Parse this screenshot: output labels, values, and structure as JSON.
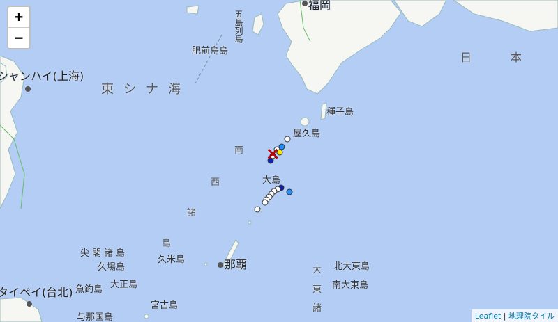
{
  "zoom": {
    "in_label": "+",
    "out_label": "−"
  },
  "labels": {
    "fukuoka": "福岡",
    "goto": "五島列島",
    "hizen": "肥前鳥島",
    "shanghai": "シャンハイ(上海)",
    "east_china_sea": "東シナ海",
    "japan": "日　本",
    "tanegashima": "種子島",
    "yakushima": "屋久島",
    "nansei_1": "南",
    "nansei_2": "西",
    "nansei_3": "諸",
    "nansei_4": "島",
    "oshima": "大島",
    "senkaku": "尖閣諸島",
    "kubashima": "久場島",
    "kumejima": "久米島",
    "naha": "那覇",
    "kitadaito": "北大東島",
    "minamidaito": "南大東島",
    "daito_1": "大",
    "daito_2": "東",
    "daito_3": "諸",
    "uotsuri": "魚釣島",
    "taisho": "大正島",
    "miyako": "宮古島",
    "taipei": "タイペイ(台北)",
    "yonaguni": "与那国島"
  },
  "attribution": {
    "leaflet": "Leaflet",
    "separator": " | ",
    "source": "地理院タイル"
  },
  "markers": {
    "epicenter": "✕",
    "colors": {
      "white": "#ffffff",
      "blue": "#1e90ff",
      "navy": "#1020b0",
      "yellow": "#ffe600",
      "cross": "#d40000"
    }
  }
}
